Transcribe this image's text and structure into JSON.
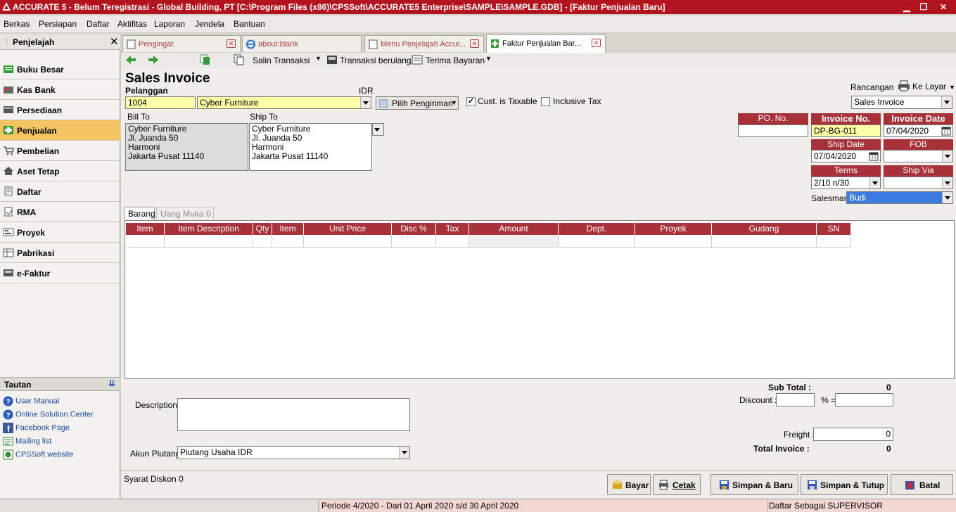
{
  "window": {
    "title": "ACCURATE 5  - Belum Teregistrasi - Global Building, PT   [C:\\Program Files (x86)\\CPSSoft\\ACCURATE5 Enterprise\\SAMPLE\\SAMPLE.GDB] - [Faktur Penjualan Baru]"
  },
  "menu": [
    "Berkas",
    "Persiapan",
    "Daftar",
    "Aktifitas",
    "Laporan",
    "Jendela",
    "Bantuan"
  ],
  "sidebar": {
    "title": "Penjelajah",
    "items": [
      "Buku Besar",
      "Kas Bank",
      "Persediaan",
      "Penjualan",
      "Pembelian",
      "Aset Tetap",
      "Daftar",
      "RMA",
      "Proyek",
      "Pabrikasi",
      "e-Faktur"
    ],
    "active": "Penjualan",
    "tautan_title": "Tautan",
    "links": [
      "User Manual",
      "Online Solution Center",
      "Facebook Page",
      "Mailing list",
      "CPSSoft website"
    ]
  },
  "tabs": [
    "Pengingat",
    "about:blank",
    "Menu Penjelajah Accur...",
    "Faktur Penjualan Bar..."
  ],
  "toolbar": {
    "salin": "Salin Transaksi",
    "berulang": "Transaksi berulang",
    "terima": "Terima Bayaran"
  },
  "form": {
    "heading": "Sales Invoice",
    "pelanggan_label": "Pelanggan",
    "currency": "IDR",
    "customer_code": "1004",
    "customer_name": "Cyber Furniture",
    "pilih_pengiriman": "Pilih Pengiriman",
    "cust_taxable": "Cust. is Taxable",
    "inclusive_tax": "Inclusive Tax",
    "bill_to_label": "Bill To",
    "ship_to_label": "Ship To",
    "bill_to": [
      "Cyber Furniture",
      "Jl. Juanda 50",
      "Harmoni",
      "Jakarta Pusat 11140"
    ],
    "ship_to": [
      "Cyber Furniture",
      "Jl. Juanda 50",
      "Harmoni",
      "Jakarta Pusat 11140"
    ],
    "rancangan_label": "Rancangan",
    "ke_layar": "Ke Layar",
    "rancangan_value": "Sales Invoice",
    "po_no_label": "PO. No.",
    "po_no_value": "",
    "invoice_no_label": "Invoice No.",
    "invoice_no_value": "DP-BG-011",
    "invoice_date_label": "Invoice Date",
    "invoice_date_value": "07/04/2020",
    "ship_date_label": "Ship Date",
    "ship_date_value": "07/04/2020",
    "fob_label": "FOB",
    "terms_label": "Terms",
    "terms_value": "2/10 n/30",
    "ship_via_label": "Ship Via",
    "salesman_label": "Salesman",
    "salesman_value": "Budi",
    "subtab_barang": "Barang",
    "subtab_uang_muka": "Uang Muka",
    "uang_muka_count": "0",
    "columns": [
      "Item",
      "Item Description",
      "Qty",
      "Item Unit",
      "Unit Price",
      "Disc %",
      "Tax",
      "Amount",
      "Dept.",
      "Proyek",
      "Gudang",
      "SN"
    ],
    "description_label": "Description:",
    "akun_piutang_label": "Akun Piutang",
    "akun_piutang_value": "Piutang Usaha IDR",
    "sub_total_label": "Sub Total :",
    "sub_total_value": "0",
    "discount_label": "Discount :",
    "percent_label": "% =",
    "freight_label": "Freight :",
    "freight_value": "0",
    "total_invoice_label": "Total Invoice :",
    "total_invoice_value": "0",
    "syarat_diskon": "Syarat Diskon 0"
  },
  "buttons": {
    "bayar": "Bayar",
    "cetak": "Cetak",
    "simpan_baru": "Simpan & Baru",
    "simpan_tutup": "Simpan & Tutup",
    "batal": "Batal"
  },
  "status": {
    "periode": "Periode 4/2020 - Dari 01 April 2020 s/d 30 April 2020",
    "user": "Daftar Sebagai SUPERVISOR"
  },
  "colors": {
    "accent": "#b3121f",
    "header_red": "#a8323a",
    "active_nav": "#f5c563"
  }
}
